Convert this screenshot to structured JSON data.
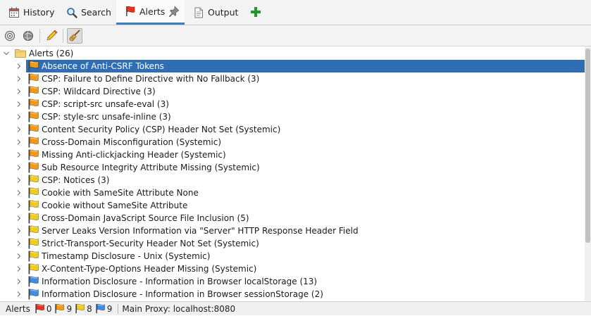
{
  "tabs": [
    {
      "label": "History",
      "icon": "calendar-icon"
    },
    {
      "label": "Search",
      "icon": "magnifier-icon"
    },
    {
      "label": "Alerts",
      "icon": "alert-flag-icon",
      "active": true
    },
    {
      "label": "Output",
      "icon": "document-icon"
    }
  ],
  "colors": {
    "selected_row": "#2f6eb5",
    "active_tab_underline": "#3c7fc0",
    "flag_high": "#e8321e",
    "flag_medium": "#f39a12",
    "flag_low": "#f2cd18",
    "flag_info": "#3f8de0"
  },
  "tree": {
    "root_label": "Alerts (26)",
    "items": [
      {
        "label": "Absence of Anti-CSRF Tokens",
        "risk": "medium",
        "selected": true
      },
      {
        "label": "CSP: Failure to Define Directive with No Fallback (3)",
        "risk": "medium"
      },
      {
        "label": "CSP: Wildcard Directive (3)",
        "risk": "medium"
      },
      {
        "label": "CSP: script-src unsafe-eval (3)",
        "risk": "medium"
      },
      {
        "label": "CSP: style-src unsafe-inline (3)",
        "risk": "medium"
      },
      {
        "label": "Content Security Policy (CSP) Header Not Set (Systemic)",
        "risk": "medium"
      },
      {
        "label": "Cross-Domain Misconfiguration (Systemic)",
        "risk": "medium"
      },
      {
        "label": "Missing Anti-clickjacking Header (Systemic)",
        "risk": "medium"
      },
      {
        "label": "Sub Resource Integrity Attribute Missing (Systemic)",
        "risk": "medium"
      },
      {
        "label": "CSP: Notices (3)",
        "risk": "low"
      },
      {
        "label": "Cookie with SameSite Attribute None",
        "risk": "low"
      },
      {
        "label": "Cookie without SameSite Attribute",
        "risk": "low"
      },
      {
        "label": "Cross-Domain JavaScript Source File Inclusion (5)",
        "risk": "low"
      },
      {
        "label": "Server Leaks Version Information via \"Server\" HTTP Response Header Field",
        "risk": "low"
      },
      {
        "label": "Strict-Transport-Security Header Not Set (Systemic)",
        "risk": "low"
      },
      {
        "label": "Timestamp Disclosure - Unix (Systemic)",
        "risk": "low"
      },
      {
        "label": "X-Content-Type-Options Header Missing (Systemic)",
        "risk": "low"
      },
      {
        "label": "Information Disclosure - Information in Browser localStorage (13)",
        "risk": "info"
      },
      {
        "label": "Information Disclosure - Information in Browser sessionStorage (2)",
        "risk": "info"
      }
    ]
  },
  "footer": {
    "alerts_label": "Alerts",
    "high_count": "0",
    "medium_count": "9",
    "low_count": "8",
    "info_count": "9",
    "proxy": "Main Proxy: localhost:8080"
  }
}
